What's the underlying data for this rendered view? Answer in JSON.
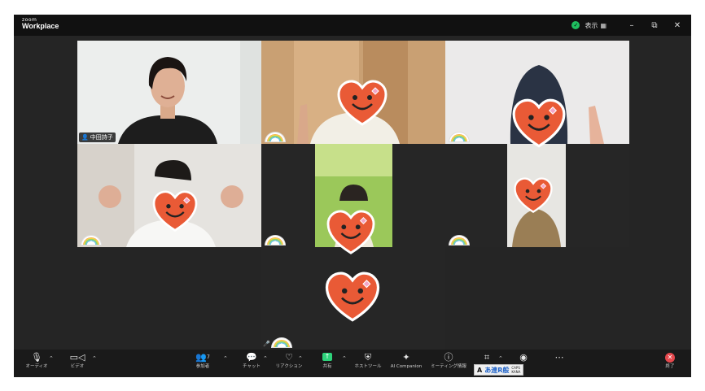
{
  "app": {
    "logo_top": "zoom",
    "logo_bottom": "Workplace",
    "view_label": "表示",
    "view_icon": "grid-icon",
    "secure_icon": "shield-check-icon"
  },
  "window_controls": {
    "minimize": "–",
    "restore": "⧉",
    "close": "✕"
  },
  "participants": [
    {
      "id": "p1",
      "name_tag": "中田詩子",
      "active_speaker": true,
      "avatar": "camera-video"
    },
    {
      "id": "p2",
      "avatar": "heart-smiley"
    },
    {
      "id": "p3",
      "avatar": "heart-smiley"
    },
    {
      "id": "p4",
      "avatar": "heart-smiley"
    },
    {
      "id": "p5",
      "avatar": "heart-smiley"
    },
    {
      "id": "p6",
      "avatar": "heart-smiley"
    },
    {
      "id": "p7",
      "avatar": "heart-smiley"
    }
  ],
  "toolbar": {
    "audio": "オーディオ",
    "video": "ビデオ",
    "participants": "参加者",
    "participants_count": "7",
    "chat": "チャット",
    "reactions": "リアクション",
    "share": "共有",
    "host_tools": "ホストツール",
    "ai_companion": "AI Companion",
    "meeting_info": "ミーティング情報",
    "end": "終了"
  },
  "ime": {
    "label_a": "A",
    "label_main": "あ連R般",
    "caps": "CAPS",
    "kana": "KANA"
  },
  "colors": {
    "active_border": "#2ed37b",
    "share_green": "#2ed37b",
    "end_red": "#e5484d",
    "heart": "#e95a36",
    "heart_outline": "#ffffff",
    "sparkle": "#f4a6c8"
  }
}
